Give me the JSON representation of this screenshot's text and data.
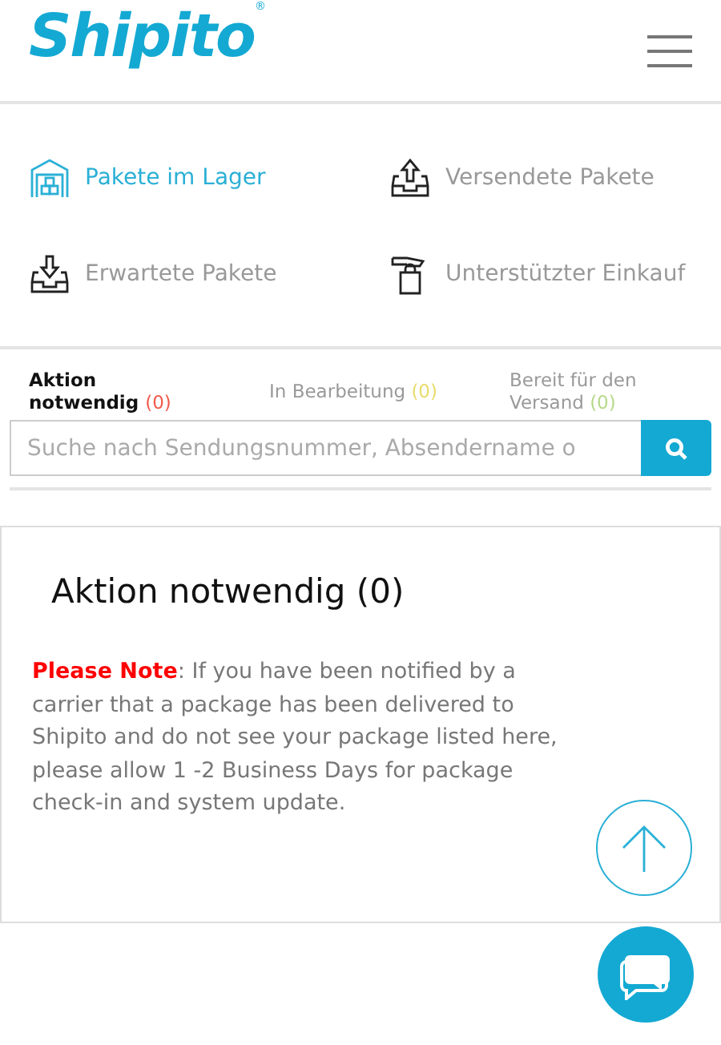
{
  "header": {
    "logo": "Shipito",
    "logo_mark": "®"
  },
  "nav": [
    {
      "label": "Pakete im Lager",
      "selected": true,
      "kind": "warehouse"
    },
    {
      "label": "Versendete Pakete",
      "selected": false,
      "kind": "outbox"
    },
    {
      "label": "Erwartete Pakete",
      "selected": false,
      "kind": "inbox"
    },
    {
      "label": "Unterstützter Einkauf",
      "selected": false,
      "kind": "shopping"
    }
  ],
  "tabs": [
    {
      "label": "Aktion notwendig",
      "count": "(0)",
      "color": "#f05a4a",
      "selected": true
    },
    {
      "label": "In Bearbeitung",
      "count": "(0)",
      "color": "#e8dc6a",
      "selected": false
    },
    {
      "label": "Bereit für den Versand",
      "count": "(0)",
      "color": "#b6d98a",
      "selected": false
    }
  ],
  "search": {
    "placeholder": "Suche nach Sendungsnummer, Absendername o"
  },
  "panel": {
    "title": "Aktion notwendig (0)",
    "note": "**Please Note**: If you have been notified by a carrier that a package has been delivered to Shipito and do not see your package listed here, please allow 1 -2 Business Days for package check-in and system update."
  }
}
